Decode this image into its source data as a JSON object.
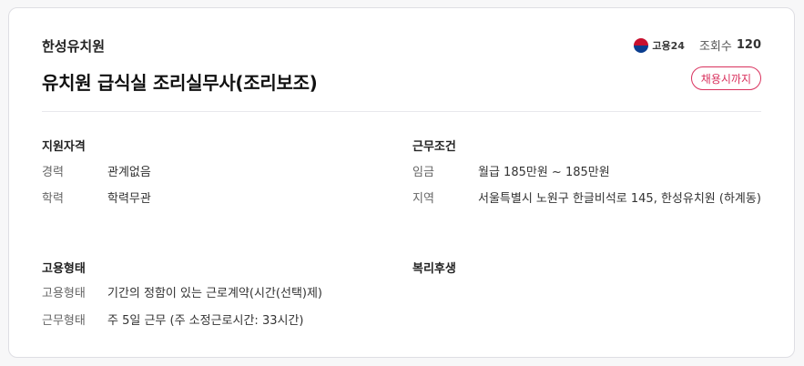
{
  "company": "한성유치원",
  "title": "유치원 급식실 조리실무사(조리보조)",
  "source_logo_text": "고용24",
  "views": {
    "label": "조회수",
    "count": "120"
  },
  "deadline_badge": "채용시까지",
  "sections": {
    "qualification": {
      "title": "지원자격",
      "rows": [
        {
          "key": "경력",
          "value": "관계없음"
        },
        {
          "key": "학력",
          "value": "학력무관"
        }
      ]
    },
    "conditions": {
      "title": "근무조건",
      "rows": [
        {
          "key": "임금",
          "value": "월급 185만원 ~ 185만원"
        },
        {
          "key": "지역",
          "value": "서울특별시 노원구 한글비석로 145, 한성유치원 (하계동)"
        }
      ]
    },
    "employment": {
      "title": "고용형태",
      "rows": [
        {
          "key": "고용형태",
          "value": "기간의 정함이 있는 근로계약(시간(선택)제)"
        },
        {
          "key": "근무형태",
          "value": "주 5일 근무 (주 소정근로시간: 33시간)"
        }
      ]
    },
    "welfare": {
      "title": "복리후생"
    }
  }
}
